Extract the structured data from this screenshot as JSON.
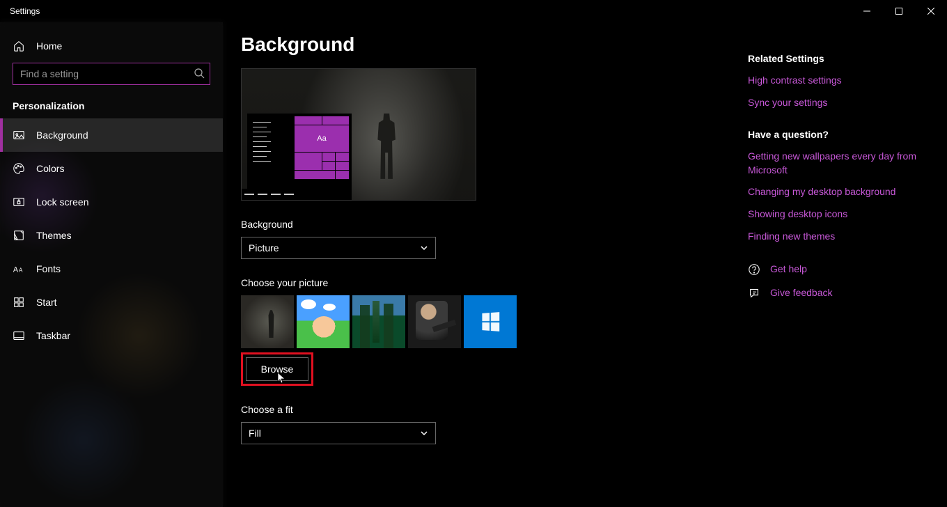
{
  "window": {
    "title": "Settings"
  },
  "sidebar": {
    "home": "Home",
    "search_placeholder": "Find a setting",
    "group": "Personalization",
    "items": [
      {
        "label": "Background",
        "icon": "picture-icon",
        "active": true
      },
      {
        "label": "Colors",
        "icon": "palette-icon"
      },
      {
        "label": "Lock screen",
        "icon": "lockscreen-icon"
      },
      {
        "label": "Themes",
        "icon": "themes-icon"
      },
      {
        "label": "Fonts",
        "icon": "fonts-icon"
      },
      {
        "label": "Start",
        "icon": "start-icon"
      },
      {
        "label": "Taskbar",
        "icon": "taskbar-icon"
      }
    ]
  },
  "page": {
    "title": "Background",
    "preview_sample_text": "Aa",
    "background_label": "Background",
    "background_value": "Picture",
    "choose_picture_label": "Choose your picture",
    "thumbnails": [
      {
        "name": "wallpaper-robot"
      },
      {
        "name": "wallpaper-cartoon"
      },
      {
        "name": "wallpaper-nature"
      },
      {
        "name": "wallpaper-action"
      },
      {
        "name": "wallpaper-windows"
      }
    ],
    "browse_label": "Browse",
    "fit_label": "Choose a fit",
    "fit_value": "Fill"
  },
  "right": {
    "related_title": "Related Settings",
    "related_links": [
      "High contrast settings",
      "Sync your settings"
    ],
    "question_title": "Have a question?",
    "question_links": [
      "Getting new wallpapers every day from Microsoft",
      "Changing my desktop background",
      "Showing desktop icons",
      "Finding new themes"
    ],
    "help_label": "Get help",
    "feedback_label": "Give feedback"
  }
}
